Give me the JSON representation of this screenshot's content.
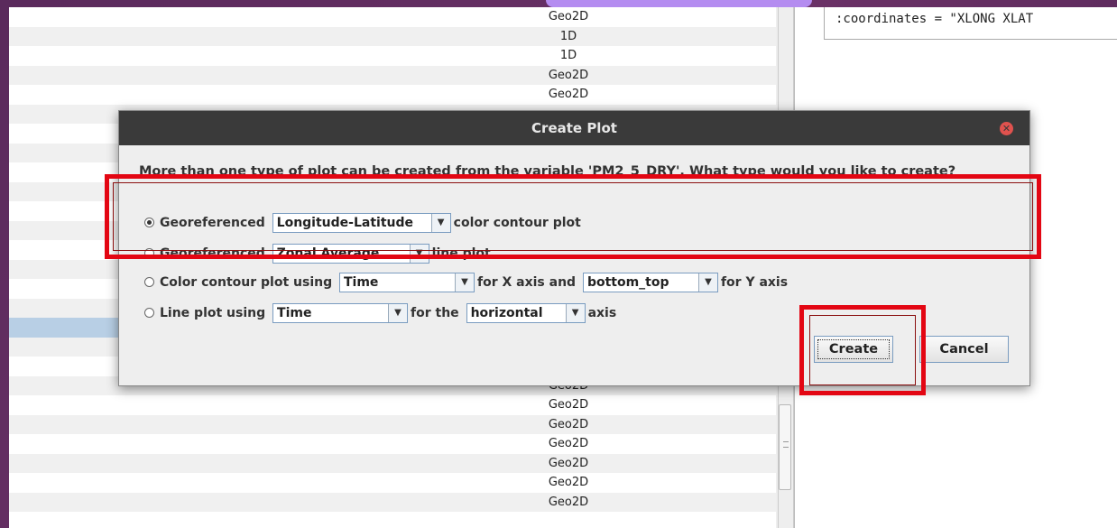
{
  "table": {
    "rows": [
      {
        "type": "Geo2D",
        "stripe": false,
        "selected": false
      },
      {
        "type": "1D",
        "stripe": true,
        "selected": false
      },
      {
        "type": "1D",
        "stripe": false,
        "selected": false
      },
      {
        "type": "Geo2D",
        "stripe": true,
        "selected": false
      },
      {
        "type": "Geo2D",
        "stripe": false,
        "selected": false
      },
      {
        "type": "",
        "stripe": true,
        "selected": false
      },
      {
        "type": "",
        "stripe": false,
        "selected": false
      },
      {
        "type": "",
        "stripe": true,
        "selected": false
      },
      {
        "type": "",
        "stripe": false,
        "selected": false
      },
      {
        "type": "",
        "stripe": true,
        "selected": false
      },
      {
        "type": "",
        "stripe": false,
        "selected": false
      },
      {
        "type": "",
        "stripe": true,
        "selected": false
      },
      {
        "type": "",
        "stripe": false,
        "selected": false
      },
      {
        "type": "",
        "stripe": true,
        "selected": false
      },
      {
        "type": "",
        "stripe": false,
        "selected": false
      },
      {
        "type": "",
        "stripe": true,
        "selected": false
      },
      {
        "type": "",
        "stripe": false,
        "selected": true
      },
      {
        "type": "",
        "stripe": true,
        "selected": false
      },
      {
        "type": "",
        "stripe": false,
        "selected": false
      },
      {
        "type": "Geo2D",
        "stripe": true,
        "selected": false
      },
      {
        "type": "Geo2D",
        "stripe": false,
        "selected": false
      },
      {
        "type": "Geo2D",
        "stripe": true,
        "selected": false
      },
      {
        "type": "Geo2D",
        "stripe": false,
        "selected": false
      },
      {
        "type": "Geo2D",
        "stripe": true,
        "selected": false
      },
      {
        "type": "Geo2D",
        "stripe": false,
        "selected": false
      },
      {
        "type": "Geo2D",
        "stripe": true,
        "selected": false
      }
    ]
  },
  "attributes": {
    "text": ":coordinates = \"XLONG XLAT"
  },
  "dialog": {
    "title": "Create Plot",
    "message": "More than one type of plot can be created from the variable 'PM2_5_DRY'. What type would you like to create?",
    "options": [
      {
        "selected": true,
        "prefix": "Georeferenced",
        "combo": "Longitude-Latitude",
        "suffix": "color contour plot"
      },
      {
        "selected": false,
        "prefix": "Georeferenced",
        "combo": "Zonal Average",
        "suffix": "line plot"
      },
      {
        "selected": false,
        "prefix": "Color contour plot using",
        "combo": "Time",
        "middle": "for X axis and",
        "combo2": "bottom_top",
        "suffix": "for Y axis"
      },
      {
        "selected": false,
        "prefix": "Line plot using",
        "combo": "Time",
        "middle": "for the",
        "combo2": "horizontal",
        "suffix": "axis"
      }
    ],
    "create_label": "Create",
    "cancel_label": "Cancel"
  },
  "colors": {
    "annotation": "#e30613",
    "selected_row": "#b8cfe5"
  }
}
